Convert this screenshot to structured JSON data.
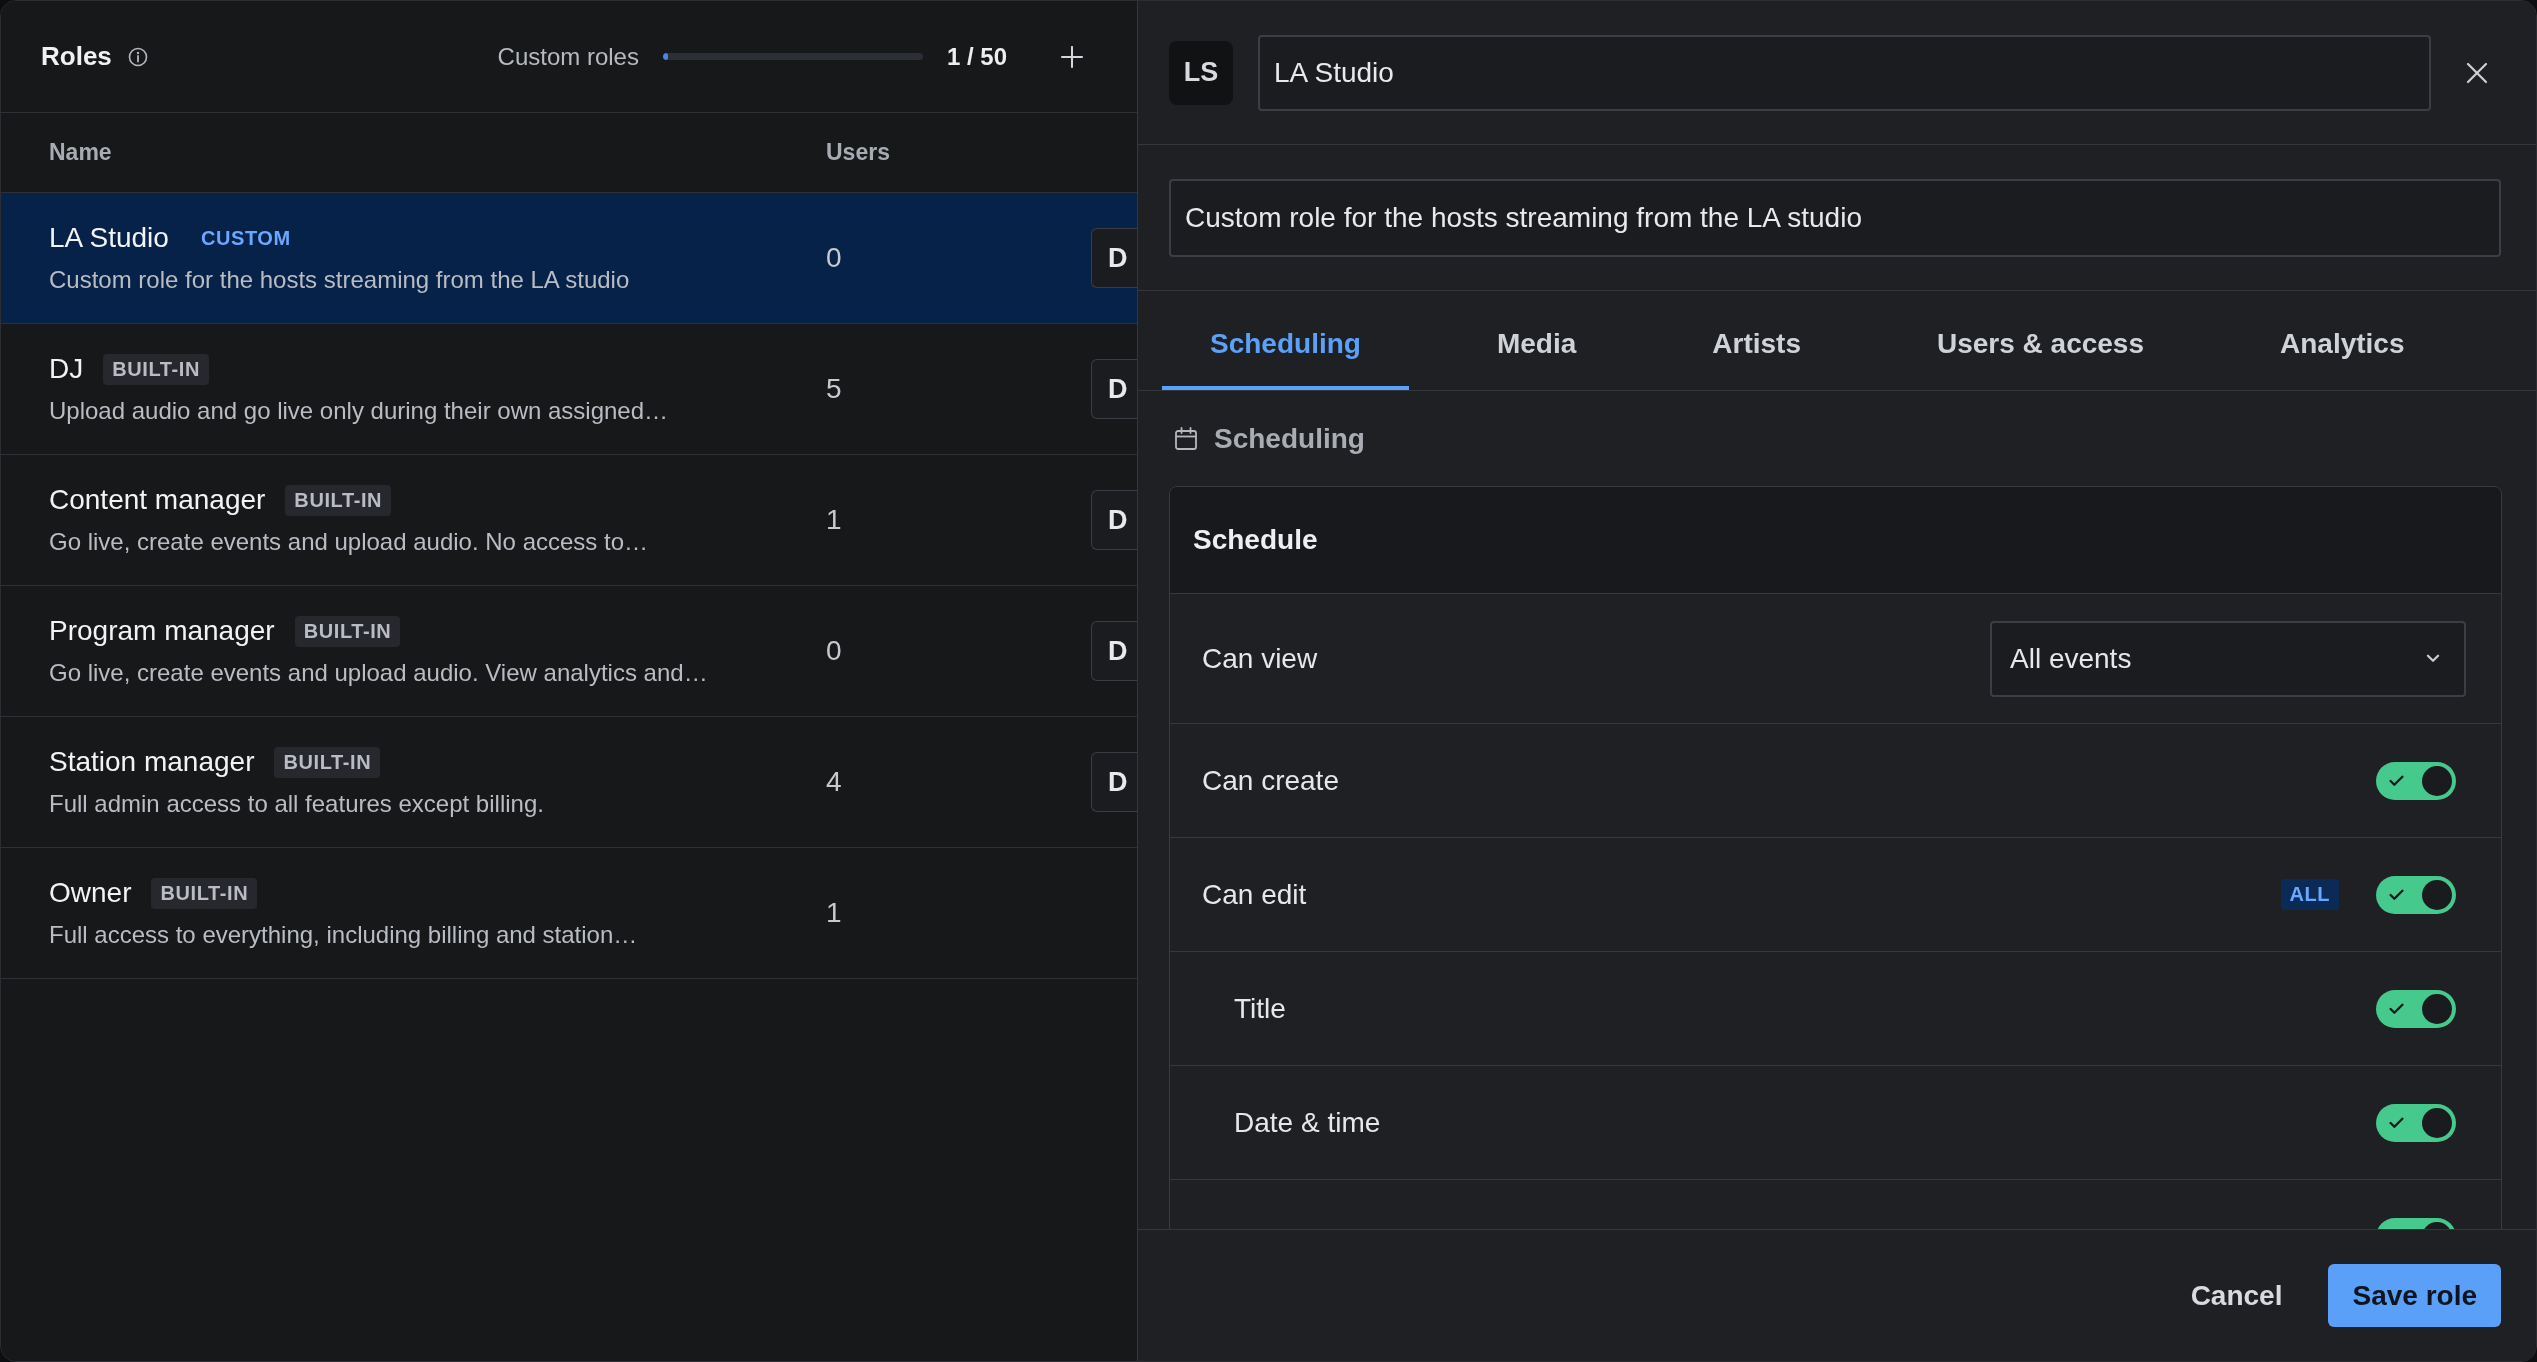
{
  "roles_panel": {
    "title": "Roles",
    "quota": {
      "label": "Custom roles",
      "level": 0.02,
      "count": "1 / 50"
    },
    "columns": [
      "Name",
      "Users"
    ],
    "rows": [
      {
        "name": "LA Studio",
        "badge": {
          "text": "CUSTOM",
          "kind": "custom"
        },
        "description": "Custom role for the hosts streaming from the LA studio",
        "users": "0",
        "action": "D",
        "selected": true
      },
      {
        "name": "DJ",
        "badge": {
          "text": "BUILT-IN",
          "kind": "builtin"
        },
        "description": "Upload audio and go live only during their own assigned…",
        "users": "5",
        "action": "D",
        "selected": false
      },
      {
        "name": "Content manager",
        "badge": {
          "text": "BUILT-IN",
          "kind": "builtin"
        },
        "description": "Go live, create events and upload audio. No access to…",
        "users": "1",
        "action": "D",
        "selected": false
      },
      {
        "name": "Program manager",
        "badge": {
          "text": "BUILT-IN",
          "kind": "builtin"
        },
        "description": "Go live, create events and upload audio. View analytics and…",
        "users": "0",
        "action": "D",
        "selected": false
      },
      {
        "name": "Station manager",
        "badge": {
          "text": "BUILT-IN",
          "kind": "builtin"
        },
        "description": "Full admin access to all features except billing.",
        "users": "4",
        "action": "D",
        "selected": false
      },
      {
        "name": "Owner",
        "badge": {
          "text": "BUILT-IN",
          "kind": "builtin"
        },
        "description": "Full access to everything, including billing and station…",
        "users": "1",
        "selected": false
      }
    ]
  },
  "editor": {
    "avatar": "LS",
    "name": {
      "value": "LA Studio"
    },
    "description": {
      "value": "Custom role for the hosts streaming from the LA studio"
    },
    "tabs": [
      {
        "label": "Scheduling",
        "selected": true
      },
      {
        "label": "Media",
        "selected": false
      },
      {
        "label": "Artists",
        "selected": false
      },
      {
        "label": "Users & access",
        "selected": false
      },
      {
        "label": "Analytics",
        "selected": false
      }
    ],
    "section_title": "Scheduling",
    "card": {
      "title": "Schedule",
      "rows": [
        {
          "kind": "select",
          "label": "Can view",
          "value": "All events"
        },
        {
          "kind": "toggle",
          "label": "Can create",
          "on": true
        },
        {
          "kind": "toggle",
          "label": "Can edit",
          "badge": "ALL",
          "on": true,
          "children": [
            {
              "kind": "toggle",
              "label": "Title",
              "on": true
            },
            {
              "kind": "toggle",
              "label": "Date & time",
              "on": true
            },
            {
              "kind": "toggle",
              "on": true
            }
          ]
        }
      ]
    }
  },
  "footer": {
    "buttons": [
      {
        "label": "Cancel",
        "kind": "text"
      },
      {
        "label": "Save role",
        "kind": "primary"
      }
    ]
  }
}
